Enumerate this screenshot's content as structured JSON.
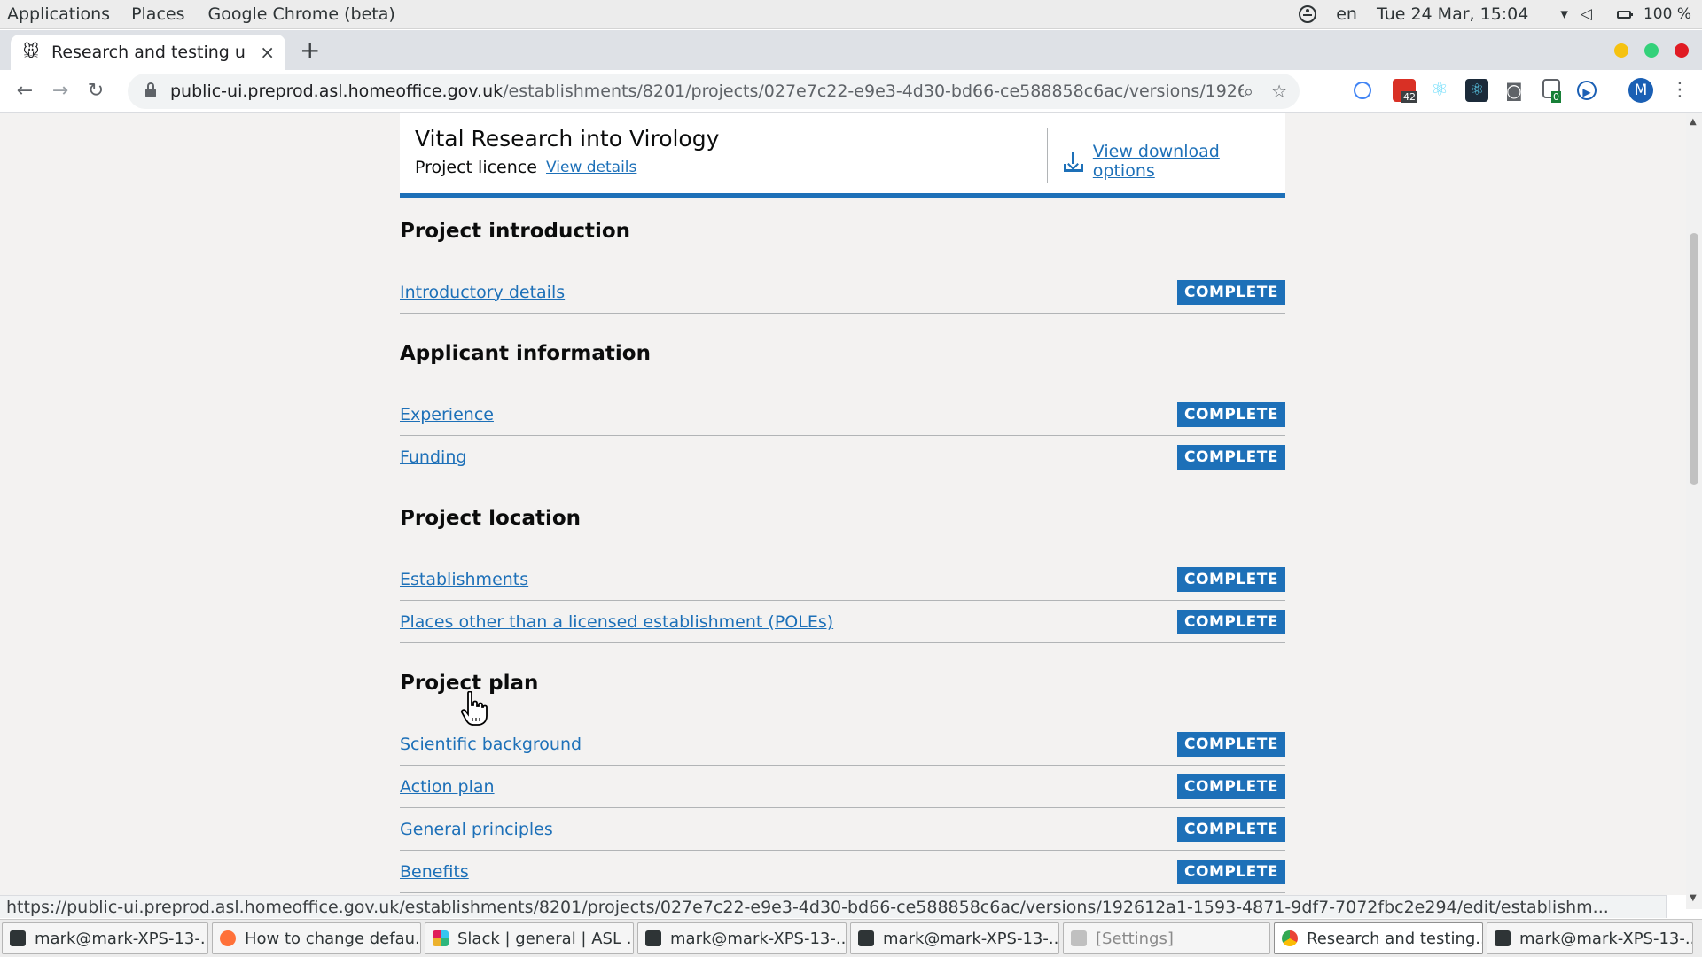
{
  "topbar": {
    "applications": "Applications",
    "places": "Places",
    "active_app": "Google Chrome (beta)",
    "language": "en",
    "clock": "Tue 24 Mar, 15:04",
    "battery": "100 %"
  },
  "tab": {
    "title": "Research and testing u",
    "close": "×",
    "new_tab": "+"
  },
  "omnibox": {
    "host": "public-ui.preprod.asl.homeoffice.gov.uk",
    "path": "/establishments/8201/projects/027e7c22-e9e3-4d30-bd66-ce588858c6ac/versions/192612a1...",
    "ext_badge_count": "42",
    "ext_badge_zero": "0",
    "profile_initial": "M"
  },
  "header": {
    "project_title": "Vital Research into Virology",
    "project_type": "Project licence",
    "view_details": "View details",
    "download": "View download options"
  },
  "status_label": "COMPLETE",
  "sections": [
    {
      "title": "Project introduction",
      "rows": [
        {
          "label": "Introductory details"
        }
      ]
    },
    {
      "title": "Applicant information",
      "rows": [
        {
          "label": "Experience"
        },
        {
          "label": "Funding"
        }
      ]
    },
    {
      "title": "Project location",
      "rows": [
        {
          "label": "Establishments"
        },
        {
          "label": "Places other than a licensed establishment (POLEs)"
        }
      ]
    },
    {
      "title": "Project plan",
      "rows": [
        {
          "label": "Scientific background"
        },
        {
          "label": "Action plan"
        },
        {
          "label": "General principles"
        },
        {
          "label": "Benefits"
        }
      ]
    }
  ],
  "status_url": "https://public-ui.preprod.asl.homeoffice.gov.uk/establishments/8201/projects/027e7c22-e9e3-4d30-bd66-ce588858c6ac/versions/192612a1-1593-4871-9df7-7072fbc2e294/edit/establishm...",
  "taskbar": [
    {
      "label": "mark@mark-XPS-13-...",
      "icon": "terminal-icon"
    },
    {
      "label": "How to change defau...",
      "icon": "firefox-icon"
    },
    {
      "label": "Slack | general | ASL ...",
      "icon": "slack-icon"
    },
    {
      "label": "mark@mark-XPS-13-...",
      "icon": "terminal-icon"
    },
    {
      "label": "mark@mark-XPS-13-...",
      "icon": "terminal-icon"
    },
    {
      "label": "[Settings]",
      "icon": "settings-icon"
    },
    {
      "label": "Research and testing...",
      "icon": "chrome-icon"
    },
    {
      "label": "mark@mark-XPS-13-...",
      "icon": "terminal-icon"
    }
  ],
  "colors": {
    "link": "#1d70b8",
    "badge_bg": "#1d70b8",
    "page_bg": "#f3f2f1"
  }
}
